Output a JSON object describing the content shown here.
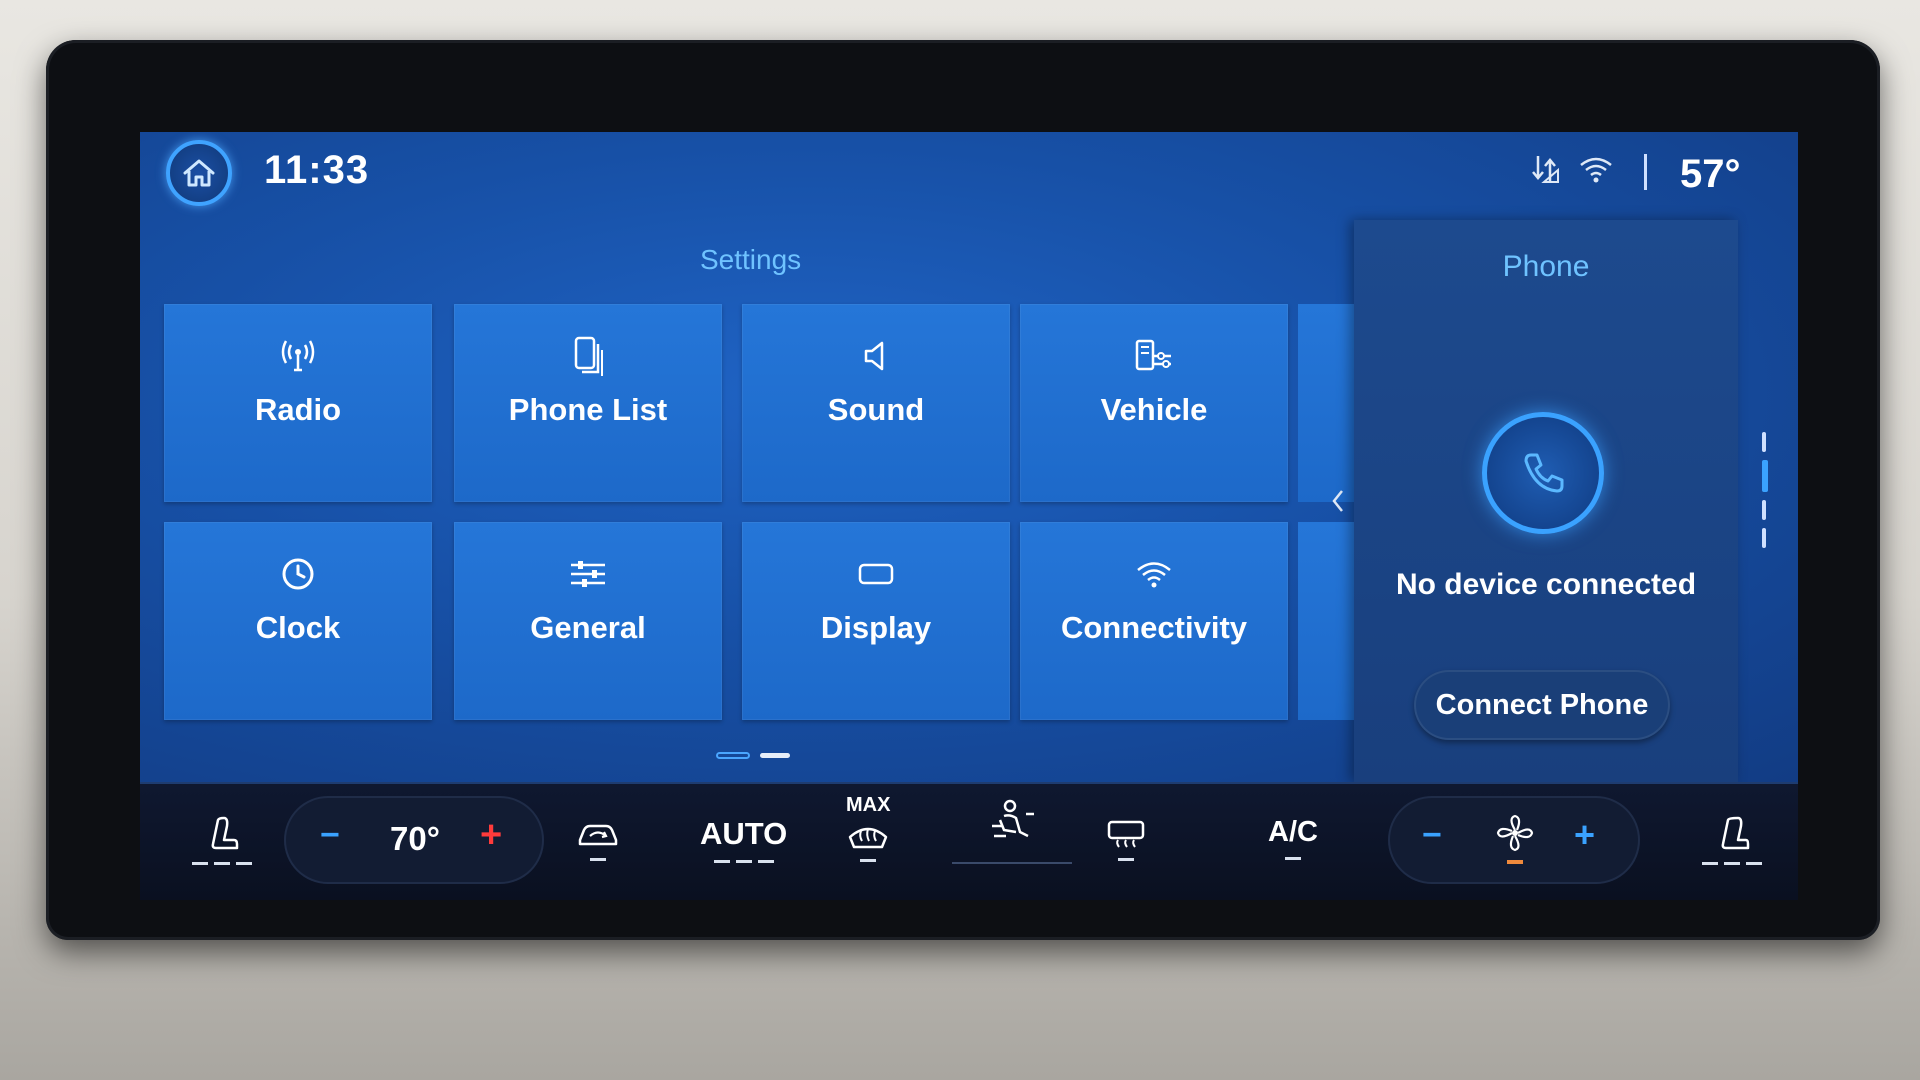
{
  "status_bar": {
    "time": "11:33",
    "outside_temp": "57°",
    "icons": [
      "data-transfer-icon",
      "wifi-icon"
    ]
  },
  "settings": {
    "title": "Settings",
    "tiles": [
      {
        "label": "Radio",
        "icon": "radio-antenna-icon"
      },
      {
        "label": "Phone List",
        "icon": "phone-list-icon"
      },
      {
        "label": "Sound",
        "icon": "speaker-icon"
      },
      {
        "label": "Vehicle",
        "icon": "vehicle-settings-icon"
      },
      {
        "label": "Clock",
        "icon": "clock-icon"
      },
      {
        "label": "General",
        "icon": "sliders-icon"
      },
      {
        "label": "Display",
        "icon": "display-icon"
      },
      {
        "label": "Connectivity",
        "icon": "wifi-icon"
      }
    ]
  },
  "phone": {
    "title": "Phone",
    "status": "No device connected",
    "connect_label": "Connect Phone"
  },
  "climate": {
    "driver_temp": "70°",
    "auto_label": "AUTO",
    "max_label": "MAX",
    "ac_label": "A/C",
    "minus": "−",
    "plus": "+"
  },
  "colors": {
    "accent": "#3aa2ff",
    "tile": "#2576d8",
    "temp_plus": "#ff3b3b",
    "fan_indicator": "#f08a3c"
  }
}
